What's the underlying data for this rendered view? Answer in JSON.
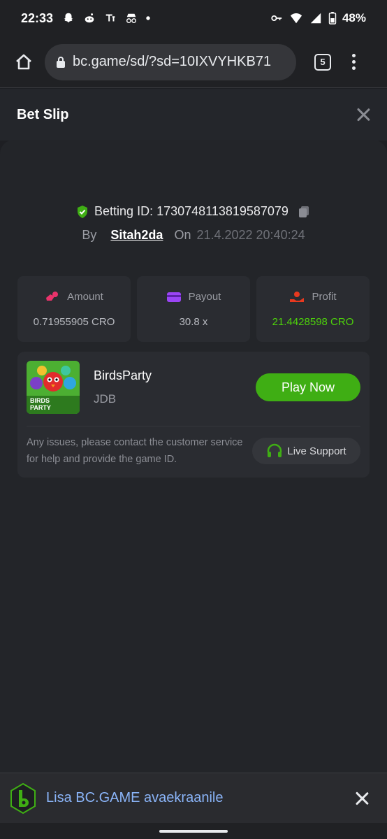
{
  "status_bar": {
    "time": "22:33",
    "battery": "48%",
    "left_icons": [
      "snapchat-icon",
      "reddit-icon",
      "tiktok-like-icon",
      "incognito-icon",
      "dot-icon"
    ],
    "right_icons": [
      "key-icon",
      "wifi-icon",
      "signal-icon",
      "battery-icon"
    ]
  },
  "browser": {
    "url": "bc.game/sd/?sd=10IXVYHKB71",
    "tab_count": "5"
  },
  "header": {
    "title": "Bet Slip"
  },
  "bet": {
    "betting_id_label": "Betting ID: 1730748113819587079",
    "by_label": "By",
    "user": "Sitah2da",
    "on_label": "On",
    "date": "21.4.2022 20:40:24"
  },
  "stats": [
    {
      "label": "Amount",
      "value": "0.71955905 CRO",
      "icon": "amount-icon",
      "color": "#e9336b"
    },
    {
      "label": "Payout",
      "value": "30.8 x",
      "icon": "payout-icon",
      "color": "#9b45f5"
    },
    {
      "label": "Profit",
      "value": "21.4428598 CRO",
      "icon": "profit-icon",
      "color": "#e8391f"
    }
  ],
  "game": {
    "name": "BirdsParty",
    "provider": "JDB",
    "play_label": "Play Now",
    "thumb_text": "BIRDS PARTY",
    "help_text": "Any issues, please contact the customer service for help and provide the game ID.",
    "live_support_label": "Live Support"
  },
  "install_banner": {
    "text": "Lisa BC.GAME avaekraanile"
  },
  "colors": {
    "accent_green": "#3fae14",
    "profit_green": "#4dd10b",
    "background": "#1e1f23",
    "link_blue": "#8ab4f8"
  }
}
